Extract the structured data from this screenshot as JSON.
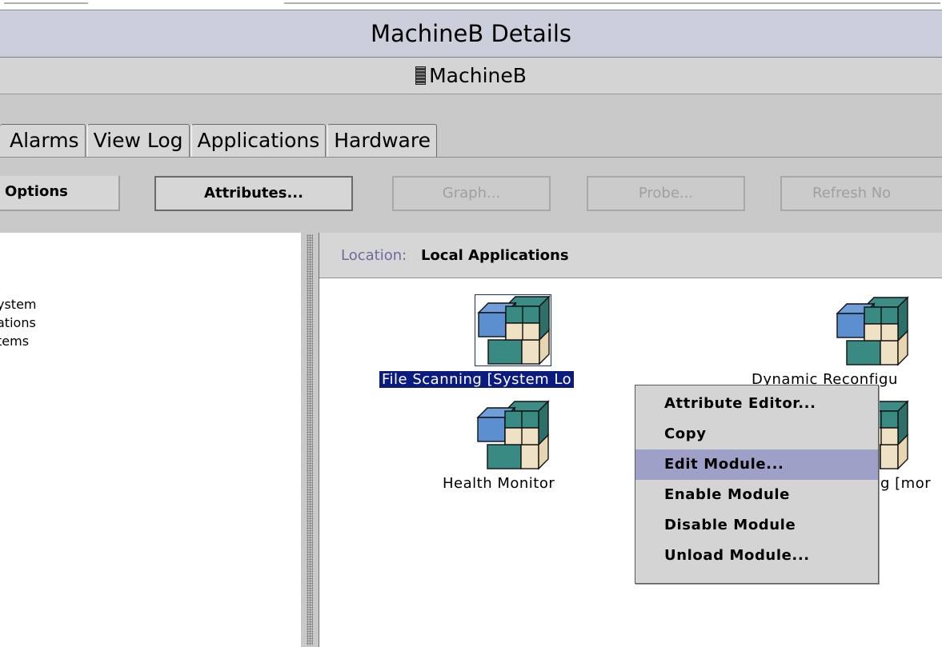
{
  "window": {
    "title": "MachineB Details",
    "host_label": "MachineB"
  },
  "tabs": [
    "Alarms",
    "View Log",
    "Applications",
    "Hardware"
  ],
  "toolbar": {
    "options_label": "Options",
    "attributes_label": "Attributes...",
    "graph_label": "Graph...",
    "probe_label": "Probe...",
    "refresh_label": "Refresh No"
  },
  "tree": {
    "items": [
      "ystem",
      "ations",
      "tems"
    ]
  },
  "location": {
    "label": "Location:",
    "value": "Local Applications"
  },
  "modules": [
    {
      "label": "File Scanning [System Lo",
      "selected": true
    },
    {
      "label": "Dynamic Reconfigu",
      "selected": false
    },
    {
      "label": "Health Monitor",
      "selected": false
    },
    {
      "label": "g [mor",
      "selected": false
    }
  ],
  "context_menu": {
    "items": [
      "Attribute Editor...",
      "Copy",
      "Edit Module...",
      "Enable Module",
      "Disable Module",
      "Unload Module..."
    ],
    "highlighted": "Edit Module..."
  },
  "colors": {
    "selection": "#0c1b7e",
    "menu_highlight": "#9ea0c8",
    "location_label": "#6b6b9e"
  }
}
